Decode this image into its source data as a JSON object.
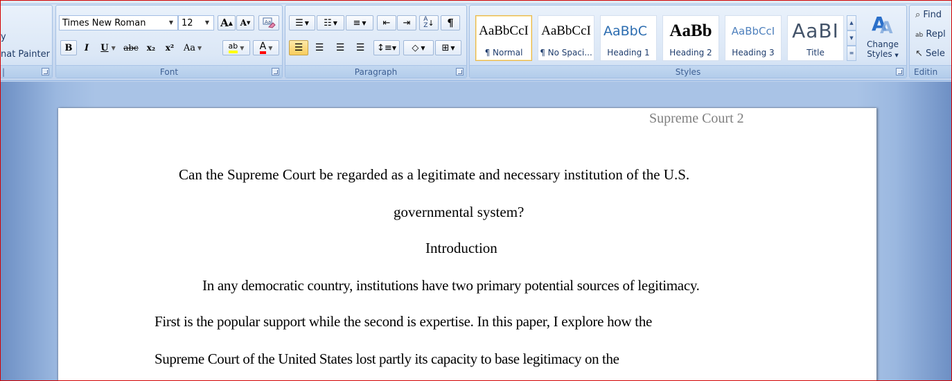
{
  "clipboard": {
    "format_painter": "nat Painter",
    "cut_partial": "y"
  },
  "font": {
    "family": "Times New Roman",
    "size": "12",
    "group_label": "Font",
    "grow": "A",
    "shrink": "A",
    "bold": "B",
    "italic": "I",
    "underline": "U",
    "strikethrough": "abc",
    "subscript": "x₂",
    "superscript": "x²",
    "change_case": "Aa",
    "highlight": "ab",
    "font_color": "A"
  },
  "paragraph": {
    "group_label": "Paragraph"
  },
  "styles": {
    "group_label": "Styles",
    "items": [
      {
        "sample": "AaBbCcI",
        "name": "¶ Normal"
      },
      {
        "sample": "AaBbCcI",
        "name": "¶ No Spaci..."
      },
      {
        "sample": "AaBbC",
        "name": "Heading 1"
      },
      {
        "sample": "AaBb",
        "name": "Heading 2"
      },
      {
        "sample": "AaBbCcI",
        "name": "Heading 3"
      },
      {
        "sample": "AaBI",
        "name": "Title"
      }
    ],
    "change_styles_line1": "Change",
    "change_styles_line2": "Styles"
  },
  "editing": {
    "group_label": "Editin",
    "find": "Find",
    "replace": "Repl",
    "select": "Sele"
  },
  "document": {
    "header": "Supreme Court 2",
    "title_line1": "Can the Supreme Court be regarded as a legitimate and necessary institution of the U.S.",
    "title_line2": "governmental system?",
    "section_heading": "Introduction",
    "para_line1": "In any democratic country, institutions have two primary potential sources of legitimacy.",
    "para_line2": "First is the popular support while the second is expertise. In this paper, I explore how the",
    "para_line3": "Supreme Court of the United States lost partly its capacity to base legitimacy on the"
  },
  "colors": {
    "ribbon_bg": "#dbe7f6",
    "highlight_yellow": "#ffff00",
    "font_color_red": "#ff0000",
    "active_button": "#f8cd5c",
    "doc_background": "#a9c3e6"
  }
}
